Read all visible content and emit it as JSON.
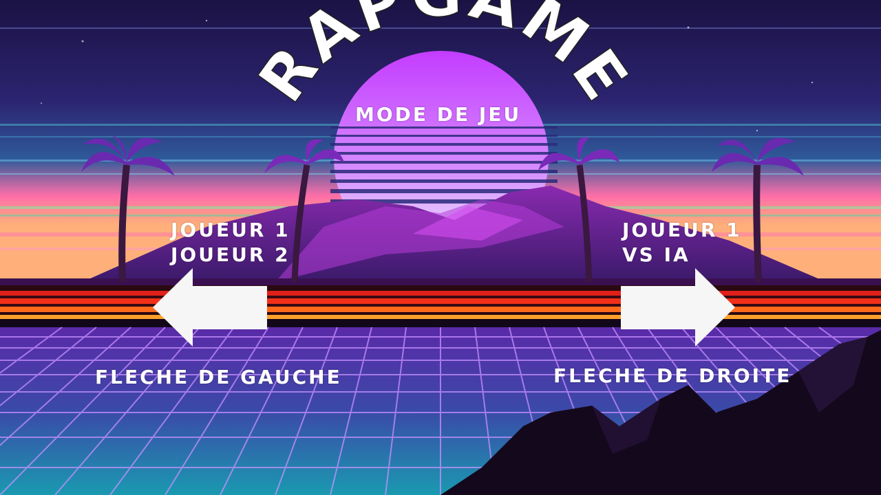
{
  "title": "RAPGAME",
  "menu": {
    "heading": "MODE DE JEU",
    "option_left": {
      "line1": "JOUEUR 1",
      "line2": "JOUEUR 2",
      "key": "FLECHE DE GAUCHE",
      "arrow_icon": "arrow-left-icon"
    },
    "option_right": {
      "line1": "JOUEUR 1",
      "line2": "VS IA",
      "key": "FLECHE DE DROITE",
      "arrow_icon": "arrow-right-icon"
    }
  },
  "colors": {
    "sky_top": "#1b1244",
    "sky_mid": "#3b2a7a",
    "sun_top": "#c43cff",
    "sun_bottom": "#e8f0ff",
    "horizon_pink": "#ff6fa8",
    "horizon_orange": "#ff9a3c",
    "stripe_red": "#e0201a",
    "grid_line": "#b47cff",
    "grid_bg_top": "#4a2a9a",
    "grid_bg_bottom": "#1a8aa8",
    "mountain_dark": "#160a20",
    "arrow_fill": "#f6f6f6",
    "text": "#ffffff"
  }
}
